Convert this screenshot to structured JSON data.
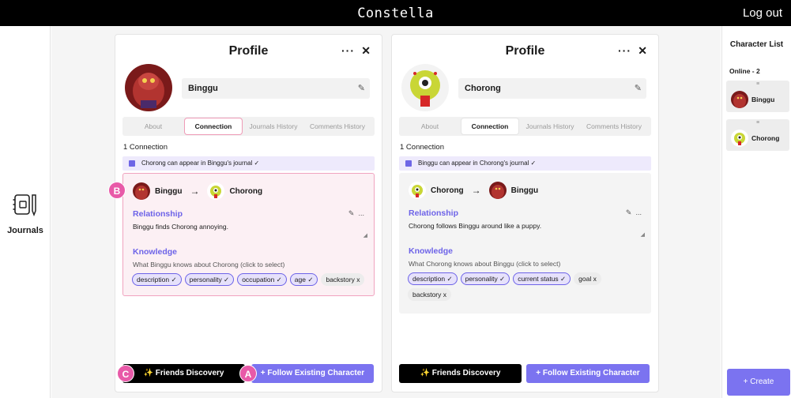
{
  "app": {
    "title": "Constella",
    "logout_label": "Log out"
  },
  "leftnav": {
    "journals_label": "Journals"
  },
  "panels": [
    {
      "title": "Profile",
      "name": "Binggu",
      "tabs": [
        "About",
        "Connection",
        "Journals History",
        "Comments History"
      ],
      "active_tab": "Connection",
      "connection_count": "1 Connection",
      "appear_text": "Chorong can appear in Binggu's journal ✓",
      "pair_from": "Binggu",
      "pair_to": "Chorong",
      "relationship_label": "Relationship",
      "relationship_text": "Binggu finds Chorong annoying.",
      "knowledge_label": "Knowledge",
      "knowledge_sub": "What Binggu knows about Chorong (click to select)",
      "chips": [
        {
          "label": "description ✓",
          "selected": true
        },
        {
          "label": "personality ✓",
          "selected": true
        },
        {
          "label": "occupation ✓",
          "selected": true
        },
        {
          "label": "age ✓",
          "selected": true
        },
        {
          "label": "backstory x",
          "selected": false
        }
      ],
      "discovery_label": "✨ Friends Discovery",
      "follow_label": "+ Follow Existing Character"
    },
    {
      "title": "Profile",
      "name": "Chorong",
      "tabs": [
        "About",
        "Connection",
        "Journals History",
        "Comments History"
      ],
      "active_tab": "Connection",
      "connection_count": "1 Connection",
      "appear_text": "Binggu can appear in Chorong's journal ✓",
      "pair_from": "Chorong",
      "pair_to": "Binggu",
      "relationship_label": "Relationship",
      "relationship_text": "Chorong follows Binggu around like a puppy.",
      "knowledge_label": "Knowledge",
      "knowledge_sub": "What Chorong knows about Binggu (click to select)",
      "chips": [
        {
          "label": "description ✓",
          "selected": true
        },
        {
          "label": "personality ✓",
          "selected": true
        },
        {
          "label": "current status ✓",
          "selected": true
        },
        {
          "label": "goal x",
          "selected": false
        },
        {
          "label": "backstory x",
          "selected": false
        }
      ],
      "discovery_label": "✨ Friends Discovery",
      "follow_label": "+ Follow Existing Character"
    }
  ],
  "annotations": {
    "a": "A",
    "b": "B",
    "c": "C"
  },
  "character_list": {
    "title": "Character List",
    "online": "Online - 2",
    "items": [
      "Binggu",
      "Chorong"
    ],
    "create_label": "+ Create"
  },
  "colors": {
    "accent": "#7b73f0",
    "badge": "#e85aa8",
    "topbar": "#000000"
  }
}
